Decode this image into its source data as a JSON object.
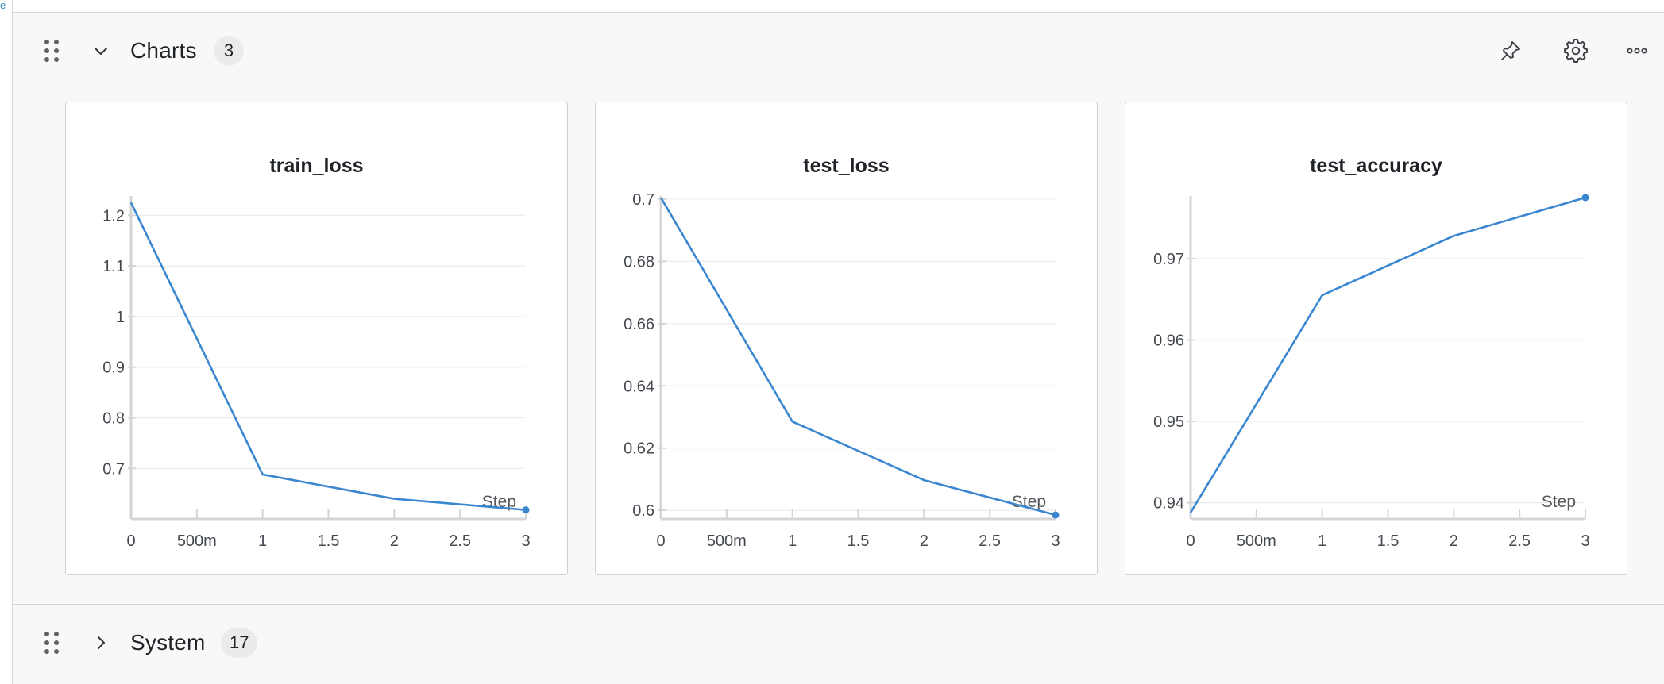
{
  "corner_mark": "e",
  "sections": {
    "charts": {
      "title": "Charts",
      "count": "3",
      "expanded": true,
      "chevron_icon": "chevron-down-icon"
    },
    "system": {
      "title": "System",
      "count": "17",
      "expanded": false,
      "chevron_icon": "chevron-right-icon"
    }
  },
  "header_actions": [
    {
      "name": "pin-icon",
      "label": "Pin section"
    },
    {
      "name": "gear-icon",
      "label": "Section settings"
    },
    {
      "name": "more-horizontal-icon",
      "label": "More options"
    }
  ],
  "colors": {
    "line": "#3a86d0",
    "grid": "#ececec",
    "axis": "#d5d5d5"
  },
  "chart_data": [
    {
      "type": "line",
      "title": "train_loss",
      "xlabel": "Step",
      "ylabel": "",
      "x": [
        0,
        1,
        2,
        3
      ],
      "series": [
        {
          "values": [
            1.225,
            0.688,
            0.64,
            0.618
          ]
        }
      ],
      "xlim": [
        0,
        3
      ],
      "ylim": [
        0.608,
        1.235
      ],
      "xticks": [
        0,
        0.5,
        1,
        1.5,
        2,
        2.5,
        3
      ],
      "xtick_labels": [
        "0",
        "500m",
        "1",
        "1.5",
        "2",
        "2.5",
        "3"
      ],
      "yticks": [
        0.7,
        0.8,
        0.9,
        1,
        1.1,
        1.2
      ],
      "ytick_labels": [
        "0.7",
        "0.8",
        "0.9",
        "1",
        "1.1",
        "1.2"
      ],
      "grid": true
    },
    {
      "type": "line",
      "title": "test_loss",
      "xlabel": "Step",
      "ylabel": "",
      "x": [
        0,
        1,
        2,
        3
      ],
      "series": [
        {
          "values": [
            0.7005,
            0.6285,
            0.6097,
            0.5985
          ]
        }
      ],
      "xlim": [
        0,
        3
      ],
      "ylim": [
        0.5985,
        0.7005
      ],
      "xticks": [
        0,
        0.5,
        1,
        1.5,
        2,
        2.5,
        3
      ],
      "xtick_labels": [
        "0",
        "500m",
        "1",
        "1.5",
        "2",
        "2.5",
        "3"
      ],
      "yticks": [
        0.6,
        0.62,
        0.64,
        0.66,
        0.68,
        0.7
      ],
      "ytick_labels": [
        "0.6",
        "0.62",
        "0.64",
        "0.66",
        "0.68",
        "0.7"
      ],
      "grid": true
    },
    {
      "type": "line",
      "title": "test_accuracy",
      "xlabel": "Step",
      "ylabel": "",
      "x": [
        0,
        1,
        2,
        3
      ],
      "series": [
        {
          "values": [
            0.9388,
            0.9655,
            0.9728,
            0.9775
          ]
        }
      ],
      "xlim": [
        0,
        3
      ],
      "ylim": [
        0.9385,
        0.9775
      ],
      "xticks": [
        0,
        0.5,
        1,
        1.5,
        2,
        2.5,
        3
      ],
      "xtick_labels": [
        "0",
        "500m",
        "1",
        "1.5",
        "2",
        "2.5",
        "3"
      ],
      "yticks": [
        0.94,
        0.95,
        0.96,
        0.97
      ],
      "ytick_labels": [
        "0.94",
        "0.95",
        "0.96",
        "0.97"
      ],
      "grid": true
    }
  ]
}
